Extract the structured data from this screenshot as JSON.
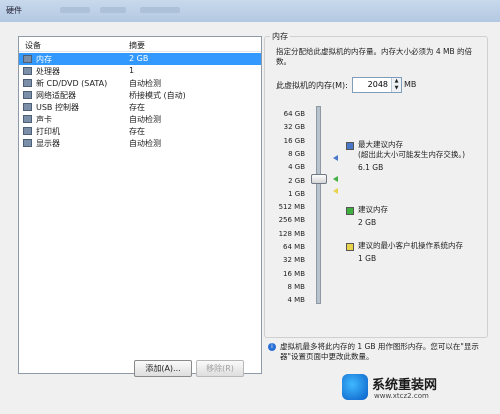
{
  "window": {
    "title": "硬件"
  },
  "device_list": {
    "col_device": "设备",
    "col_summary": "摘要",
    "rows": [
      {
        "icon": "memory-icon",
        "name": "内存",
        "summary": "2 GB",
        "selected": true
      },
      {
        "icon": "processor-icon",
        "name": "处理器",
        "summary": "1",
        "selected": false
      },
      {
        "icon": "cd-dvd-icon",
        "name": "新 CD/DVD (SATA)",
        "summary": "自动检测",
        "selected": false
      },
      {
        "icon": "network-adapter-icon",
        "name": "网络适配器",
        "summary": "桥接模式 (自动)",
        "selected": false
      },
      {
        "icon": "usb-controller-icon",
        "name": "USB 控制器",
        "summary": "存在",
        "selected": false
      },
      {
        "icon": "sound-card-icon",
        "name": "声卡",
        "summary": "自动检测",
        "selected": false
      },
      {
        "icon": "printer-icon",
        "name": "打印机",
        "summary": "存在",
        "selected": false
      },
      {
        "icon": "display-icon",
        "name": "显示器",
        "summary": "自动检测",
        "selected": false
      }
    ],
    "add_button": "添加(A)...",
    "remove_button": "移除(R)"
  },
  "memory": {
    "group_title": "内存",
    "description": "指定分配给此虚拟机的内存量。内存大小必须为 4 MB 的倍数。",
    "field_label": "此虚拟机的内存(M):",
    "value": "2048",
    "unit": "MB",
    "ticks": [
      "64 GB",
      "32 GB",
      "16 GB",
      "8 GB",
      "4 GB",
      "2 GB",
      "1 GB",
      "512 MB",
      "256 MB",
      "128 MB",
      "64 MB",
      "32 MB",
      "16 MB",
      "8 MB",
      "4 MB"
    ],
    "slider_value": "2 GB",
    "legend": [
      {
        "color": "#4a78c8",
        "title": "最大建议内存",
        "note": "(超出此大小可能发生内存交换。)",
        "value": "6.1 GB"
      },
      {
        "color": "#3fb03f",
        "title": "建议内存",
        "note": "",
        "value": "2 GB"
      },
      {
        "color": "#e8d34a",
        "title": "建议的最小客户机操作系统内存",
        "note": "",
        "value": "1 GB"
      }
    ],
    "info": "虚拟机最多将此内存的 1 GB 用作图形内存。您可以在\"显示器\"设置页面中更改此数量。"
  },
  "watermark": {
    "title": "系统重装网",
    "url": "www.xtcz2.com"
  }
}
